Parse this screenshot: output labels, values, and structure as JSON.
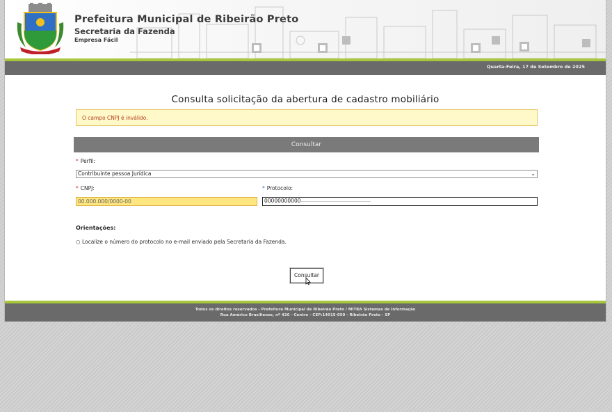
{
  "header": {
    "title": "Prefeitura Municipal de Ribeirão Preto",
    "subtitle": "Secretaria da Fazenda",
    "app_name": "Empresa Fácil",
    "date": "Quarta-Feira, 17 de Setembro de 2025"
  },
  "main": {
    "page_title": "Consulta solicitação da abertura de cadastro mobiliário",
    "error_message": "O campo CNPJ é inválido.",
    "form_title": "Consultar",
    "required_marker": "*",
    "perfil": {
      "label": "Perfil:",
      "selected_value": "Contribuinte pessoa Jurídica"
    },
    "cnpj": {
      "label": "CNPJ:",
      "value": "00.000.000/0000-00"
    },
    "protocolo": {
      "label": "Protocolo:",
      "value": "00000000000"
    },
    "orientacoes": {
      "title": "Orientações:",
      "items": [
        "Localize o número do protocolo no e-mail enviado pela Secretaria da Fazenda."
      ]
    },
    "submit_label": "Consultar"
  },
  "footer": {
    "line1": "Todos os direitos reservados - Prefeitura Municipal de Ribeirão Preto / MITRA Sistemas de Informação",
    "line2": "Rua Américo Brasiliense, nº 426 - Centro - CEP:14015-050 - Ribeirão Preto - SP"
  },
  "colors": {
    "accent_green": "#a8c73d",
    "band_gray": "#6a6a6a",
    "error_bg": "#fff8c8",
    "error_text": "#b2401f",
    "invalid_field_bg": "#ffe680"
  },
  "icons": {
    "coat_of_arms": "ribeirao-preto-coat-of-arms",
    "select_arrow": "chevron-down-icon",
    "pointer": "mouse-cursor-icon"
  }
}
